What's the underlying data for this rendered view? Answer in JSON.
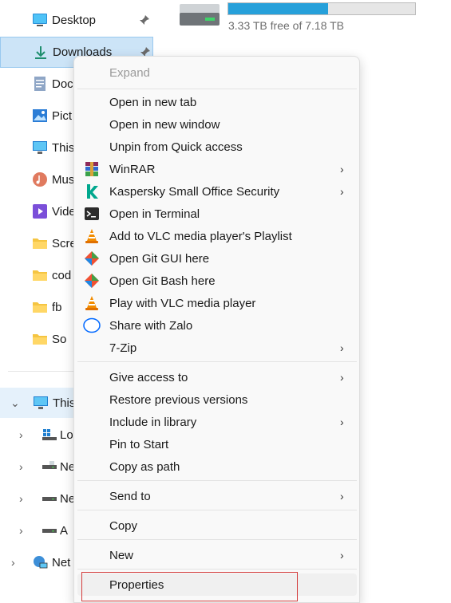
{
  "nav": {
    "quick": [
      {
        "label": "Desktop",
        "icon": "desktop-icon",
        "pinned": true
      },
      {
        "label": "Downloads",
        "icon": "download-icon",
        "pinned": true,
        "selected": true
      },
      {
        "label": "Doc",
        "icon": "documents-icon"
      },
      {
        "label": "Pict",
        "icon": "pictures-icon"
      },
      {
        "label": "This",
        "icon": "monitor-icon"
      },
      {
        "label": "Mus",
        "icon": "music-icon"
      },
      {
        "label": "Vide",
        "icon": "videos-icon"
      },
      {
        "label": "Scre",
        "icon": "folder-icon"
      },
      {
        "label": "cod",
        "icon": "folder-icon"
      },
      {
        "label": "fb",
        "icon": "folder-icon"
      },
      {
        "label": "So",
        "icon": "folder-icon"
      }
    ],
    "this_pc": {
      "label": "This",
      "icon": "monitor-icon"
    },
    "drives": [
      {
        "label": "Lo",
        "icon": "local-disk-icon"
      },
      {
        "label": "Ne",
        "icon": "network-drive-icon"
      },
      {
        "label": "Ne",
        "icon": "network-drive-icon"
      },
      {
        "label": "A",
        "icon": "network-drive-icon"
      }
    ],
    "network": {
      "label": "Net",
      "icon": "network-icon"
    }
  },
  "drive": {
    "free_text": "3.33 TB free of 7.18 TB",
    "used_fraction": 0.536,
    "bar_color": "#26a0da"
  },
  "menu": {
    "expand": "Expand",
    "items1": [
      {
        "label": "Open in new tab"
      },
      {
        "label": "Open in new window"
      },
      {
        "label": "Unpin from Quick access"
      },
      {
        "label": "WinRAR",
        "icon": "winrar-icon",
        "submenu": true
      },
      {
        "label": "Kaspersky Small Office Security",
        "icon": "kaspersky-icon",
        "submenu": true
      },
      {
        "label": "Open in Terminal",
        "icon": "terminal-icon"
      },
      {
        "label": "Add to VLC media player's Playlist",
        "icon": "vlc-icon"
      },
      {
        "label": "Open Git GUI here",
        "icon": "git-icon"
      },
      {
        "label": "Open Git Bash here",
        "icon": "git-icon"
      },
      {
        "label": "Play with VLC media player",
        "icon": "vlc-icon"
      },
      {
        "label": "Share with Zalo",
        "icon": "zalo-icon"
      },
      {
        "label": "7-Zip",
        "submenu": true
      }
    ],
    "items2": [
      {
        "label": "Give access to",
        "submenu": true
      },
      {
        "label": "Restore previous versions"
      },
      {
        "label": "Include in library",
        "submenu": true
      },
      {
        "label": "Pin to Start"
      },
      {
        "label": "Copy as path"
      }
    ],
    "send_to": "Send to",
    "copy": "Copy",
    "new": "New",
    "properties": "Properties"
  }
}
